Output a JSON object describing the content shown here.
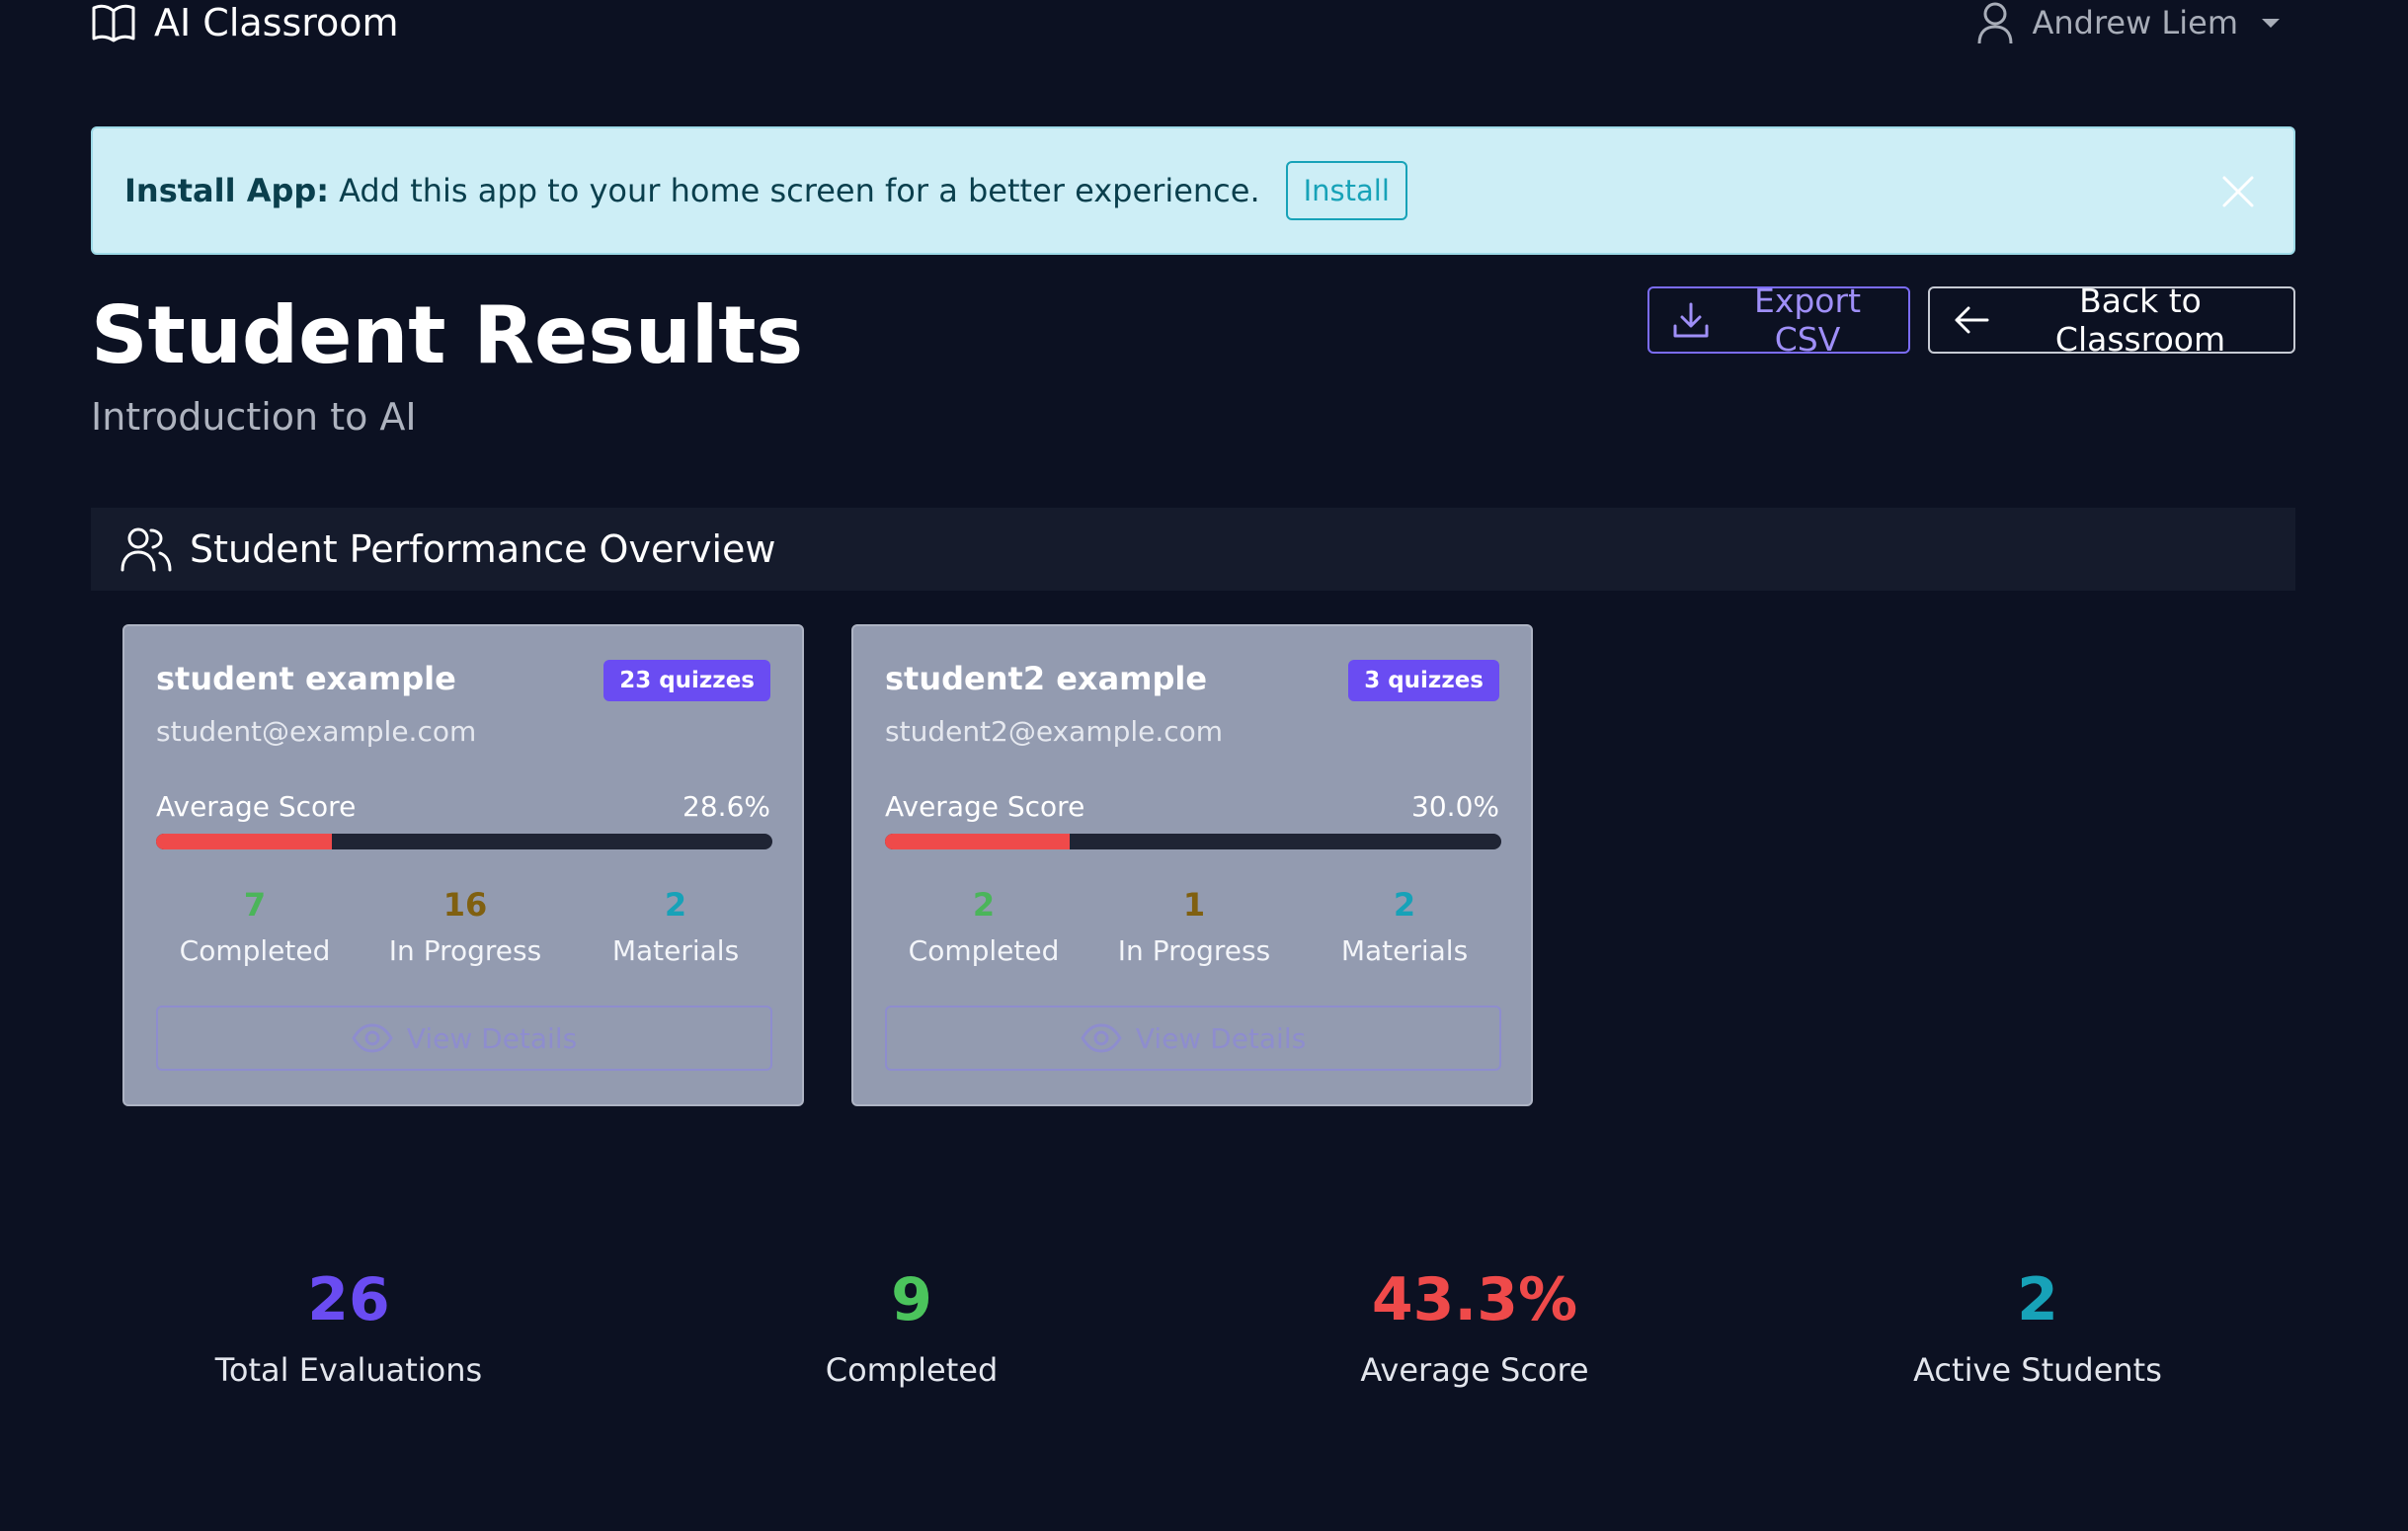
{
  "nav": {
    "brand": "AI Classroom",
    "user_name": "Andrew Liem"
  },
  "install_banner": {
    "label": "Install App:",
    "message": "Add this app to your home screen for a better experience.",
    "button": "Install"
  },
  "header": {
    "title": "Student Results",
    "subtitle": "Introduction to AI",
    "export_label": "Export CSV",
    "back_label": "Back to Classroom"
  },
  "overview": {
    "title": "Student Performance Overview"
  },
  "students": [
    {
      "name": "student example",
      "badge": "23 quizzes",
      "email": "student@example.com",
      "score_label": "Average Score",
      "score": "28.6%",
      "score_fraction": 0.286,
      "completed": "7",
      "completed_label": "Completed",
      "in_progress": "16",
      "in_progress_label": "In Progress",
      "materials": "2",
      "materials_label": "Materials",
      "details_label": "View Details"
    },
    {
      "name": "student2 example",
      "badge": "3 quizzes",
      "email": "student2@example.com",
      "score_label": "Average Score",
      "score": "30.0%",
      "score_fraction": 0.3,
      "completed": "2",
      "completed_label": "Completed",
      "in_progress": "1",
      "in_progress_label": "In Progress",
      "materials": "2",
      "materials_label": "Materials",
      "details_label": "View Details"
    }
  ],
  "summary": [
    {
      "value": "26",
      "label": "Total Evaluations",
      "color": "#6a4cf2"
    },
    {
      "value": "9",
      "label": "Completed",
      "color": "#4bc45c"
    },
    {
      "value": "43.3%",
      "label": "Average Score",
      "color": "#ef4a4a"
    },
    {
      "value": "2",
      "label": "Active Students",
      "color": "#17a2b8"
    }
  ],
  "colors": {
    "background": "#0c1122",
    "accent": "#6a4cf2",
    "danger": "#ef4a4a",
    "info": "#17a2b8"
  }
}
